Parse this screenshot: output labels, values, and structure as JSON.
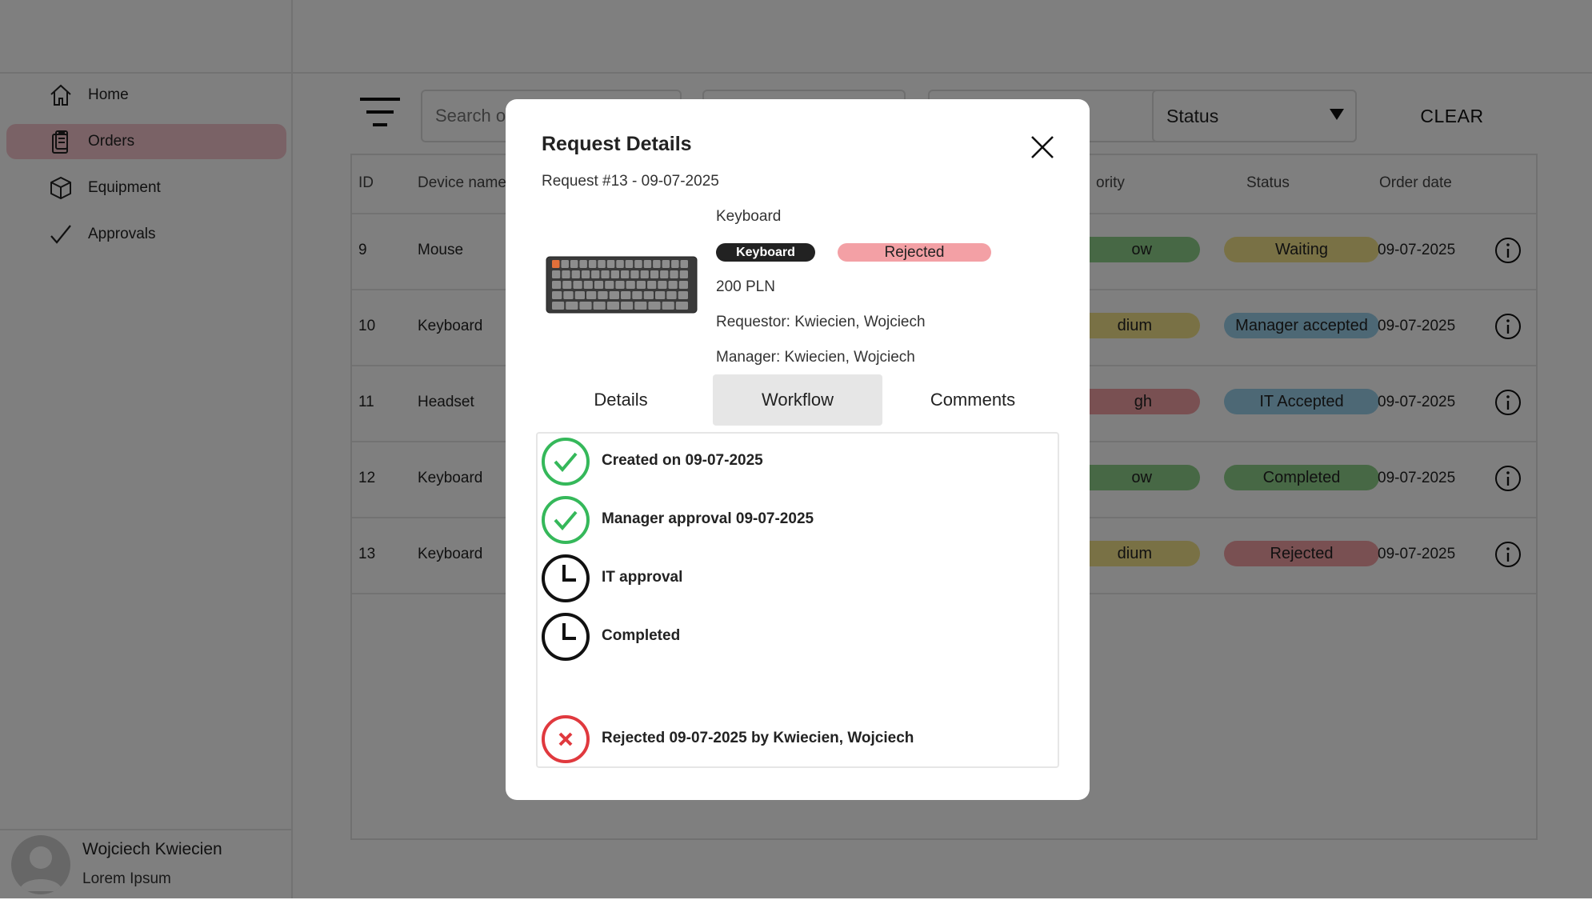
{
  "sidebar": {
    "items": [
      {
        "label": "Home",
        "icon": "home-icon"
      },
      {
        "label": "Orders",
        "icon": "clipboard-icon"
      },
      {
        "label": "Equipment",
        "icon": "box-icon"
      },
      {
        "label": "Approvals",
        "icon": "check-icon"
      }
    ],
    "active": "Orders",
    "active_color": "#f4c5cc",
    "user": {
      "name": "Wojciech Kwiecien",
      "subtitle": "Lorem Ipsum"
    }
  },
  "toolbar": {
    "search_placeholder": "Search o",
    "status_label": "Status",
    "clear_label": "CLEAR"
  },
  "table": {
    "headers": [
      "ID",
      "Device name",
      "ority",
      "Status",
      "Order date"
    ],
    "rows": [
      {
        "id": "9",
        "device": "Mouse",
        "priority": "ow",
        "priority_color": "#8fd18a",
        "status": "Waiting",
        "status_color": "#f3e38a",
        "date": "09-07-2025"
      },
      {
        "id": "10",
        "device": "Keyboard",
        "priority": "dium",
        "priority_color": "#f3e38a",
        "status": "Manager accepted",
        "status_color": "#9ad0ea",
        "date": "09-07-2025"
      },
      {
        "id": "11",
        "device": "Headset",
        "priority": "gh",
        "priority_color": "#f3a0a5",
        "status": "IT Accepted",
        "status_color": "#9ad0ea",
        "date": "09-07-2025"
      },
      {
        "id": "12",
        "device": "Keyboard",
        "priority": "ow",
        "priority_color": "#8fd18a",
        "status": "Completed",
        "status_color": "#8fd18a",
        "date": "09-07-2025"
      },
      {
        "id": "13",
        "device": "Keyboard",
        "priority": "dium",
        "priority_color": "#f3e38a",
        "status": "Rejected",
        "status_color": "#f3a0a5",
        "date": "09-07-2025"
      }
    ]
  },
  "modal": {
    "title": "Request Details",
    "subtitle": "Request #13 - 09-07-2025",
    "device": "Keyboard",
    "category_tag": "Keyboard",
    "status_tag": "Rejected",
    "price": "200 PLN",
    "requestor": "Requestor: Kwiecien, Wojciech",
    "manager": "Manager: Kwiecien, Wojciech",
    "tabs": [
      "Details",
      "Workflow",
      "Comments"
    ],
    "active_tab": "Workflow",
    "workflow": [
      {
        "text": "Created on 09-07-2025",
        "state": "done"
      },
      {
        "text": "Manager approval 09-07-2025",
        "state": "done"
      },
      {
        "text": "IT approval",
        "state": "pending"
      },
      {
        "text": "Completed",
        "state": "pending"
      },
      {
        "text": "Rejected 09-07-2025 by Kwiecien, Wojciech",
        "state": "rejected"
      }
    ]
  },
  "colors": {
    "done": "#35b85a",
    "rejected": "#e0393e",
    "pending": "#111111"
  }
}
